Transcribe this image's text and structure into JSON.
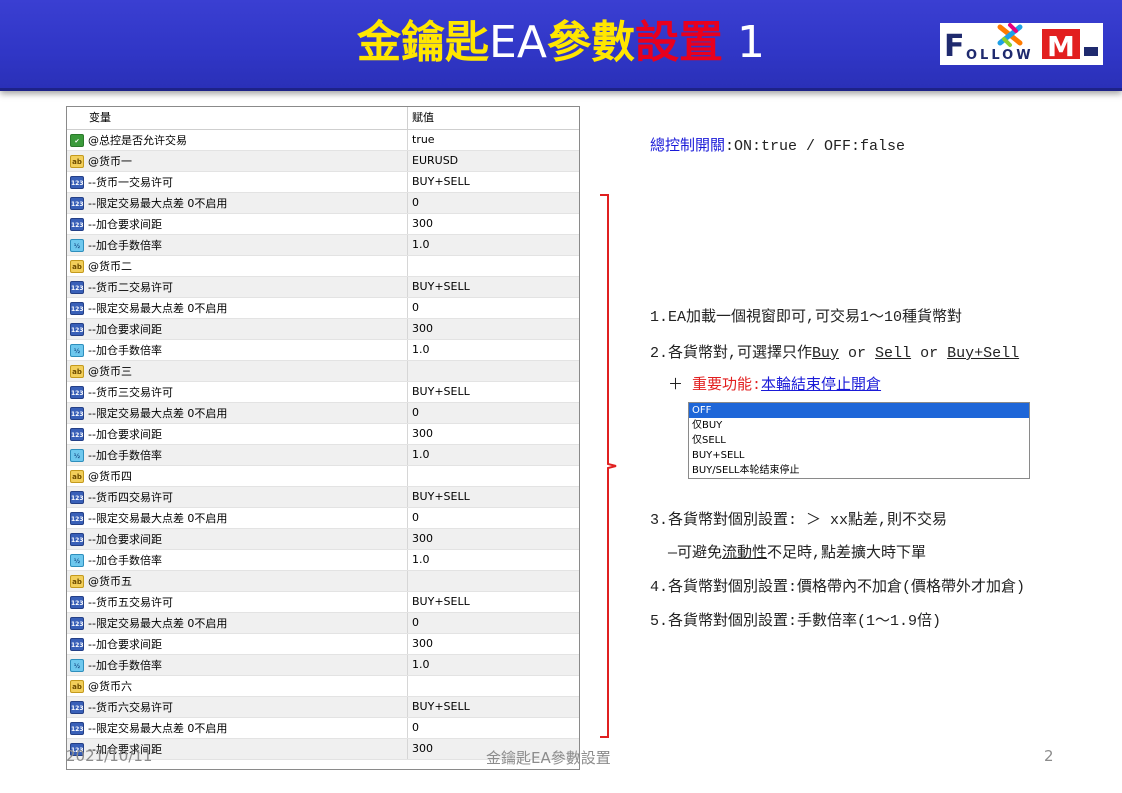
{
  "slide": {
    "title_part1": "金鑰匙",
    "title_part2": "EA",
    "title_part3": "參數",
    "title_part4": "設置",
    "title_part5": " 1",
    "logo_text_left": "F",
    "logo_text_mid": "OLLOW",
    "logo_text_right": "M"
  },
  "params": {
    "header_var": "变量",
    "header_val": "赋值",
    "rows": [
      {
        "type": "bool",
        "name": "@总控是否允许交易",
        "value": "true"
      },
      {
        "type": "str",
        "name": "@货币一",
        "value": "EURUSD"
      },
      {
        "type": "int",
        "name": "--货币一交易许可",
        "value": "BUY+SELL"
      },
      {
        "type": "int",
        "name": "--限定交易最大点差 0不启用",
        "value": "0"
      },
      {
        "type": "int",
        "name": "--加仓要求间距",
        "value": "300"
      },
      {
        "type": "dbl",
        "name": "--加仓手数倍率",
        "value": "1.0"
      },
      {
        "type": "str",
        "name": "@货币二",
        "value": ""
      },
      {
        "type": "int",
        "name": "--货币二交易许可",
        "value": "BUY+SELL"
      },
      {
        "type": "int",
        "name": "--限定交易最大点差 0不启用",
        "value": "0"
      },
      {
        "type": "int",
        "name": "--加仓要求间距",
        "value": "300"
      },
      {
        "type": "dbl",
        "name": "--加仓手数倍率",
        "value": "1.0"
      },
      {
        "type": "str",
        "name": "@货币三",
        "value": ""
      },
      {
        "type": "int",
        "name": "--货币三交易许可",
        "value": "BUY+SELL"
      },
      {
        "type": "int",
        "name": "--限定交易最大点差 0不启用",
        "value": "0"
      },
      {
        "type": "int",
        "name": "--加仓要求间距",
        "value": "300"
      },
      {
        "type": "dbl",
        "name": "--加仓手数倍率",
        "value": "1.0"
      },
      {
        "type": "str",
        "name": "@货币四",
        "value": ""
      },
      {
        "type": "int",
        "name": "--货币四交易许可",
        "value": "BUY+SELL"
      },
      {
        "type": "int",
        "name": "--限定交易最大点差 0不启用",
        "value": "0"
      },
      {
        "type": "int",
        "name": "--加仓要求间距",
        "value": "300"
      },
      {
        "type": "dbl",
        "name": "--加仓手数倍率",
        "value": "1.0"
      },
      {
        "type": "str",
        "name": "@货币五",
        "value": ""
      },
      {
        "type": "int",
        "name": "--货币五交易许可",
        "value": "BUY+SELL"
      },
      {
        "type": "int",
        "name": "--限定交易最大点差 0不启用",
        "value": "0"
      },
      {
        "type": "int",
        "name": "--加仓要求间距",
        "value": "300"
      },
      {
        "type": "dbl",
        "name": "--加仓手数倍率",
        "value": "1.0"
      },
      {
        "type": "str",
        "name": "@货币六",
        "value": ""
      },
      {
        "type": "int",
        "name": "--货币六交易许可",
        "value": "BUY+SELL"
      },
      {
        "type": "int",
        "name": "--限定交易最大点差 0不启用",
        "value": "0"
      },
      {
        "type": "int",
        "name": "--加仓要求间距",
        "value": "300"
      }
    ]
  },
  "notes": {
    "master_label": "總控制開關",
    "master_text": ":ON:true / OFF:false",
    "line1": "1.EA加載一個視窗即可,可交易1～10種貨幣對",
    "line2_prefix": "2.各貨幣對,可選擇只作",
    "line2_buy": "Buy",
    "line2_or1": " or ",
    "line2_sell": "Sell",
    "line2_or2": " or ",
    "line2_both": "Buy+Sell",
    "line_plus": "＋ ",
    "line_plus_red": "重要功能:",
    "line_plus_link": "本輪結束停止開倉",
    "line3": "3.各貨幣對個別設置: ＞ xx點差,則不交易",
    "line3b_prefix": "—可避免",
    "line3b_u": "流動性",
    "line3b_suffix": "不足時,點差擴大時下單",
    "line4": "4.各貨幣對個別設置:價格帶內不加倉(價格帶外才加倉)",
    "line5": "5.各貨幣對個別設置:手數倍率(1～1.9倍)"
  },
  "dropdown": {
    "options": [
      "OFF",
      "仅BUY",
      "仅SELL",
      "BUY+SELL",
      "BUY/SELL本轮结束停止"
    ],
    "selected": "OFF"
  },
  "footer": {
    "date": "2021/10/11",
    "center": "金鑰匙EA參數設置",
    "page": "2"
  },
  "colors": {
    "banner": "#3036c6",
    "title_yellow": "#ffe600",
    "title_red": "#e8001e",
    "note_blue": "#1a1ad8",
    "note_red": "#e21f1f",
    "bracket_red": "#e02020"
  }
}
